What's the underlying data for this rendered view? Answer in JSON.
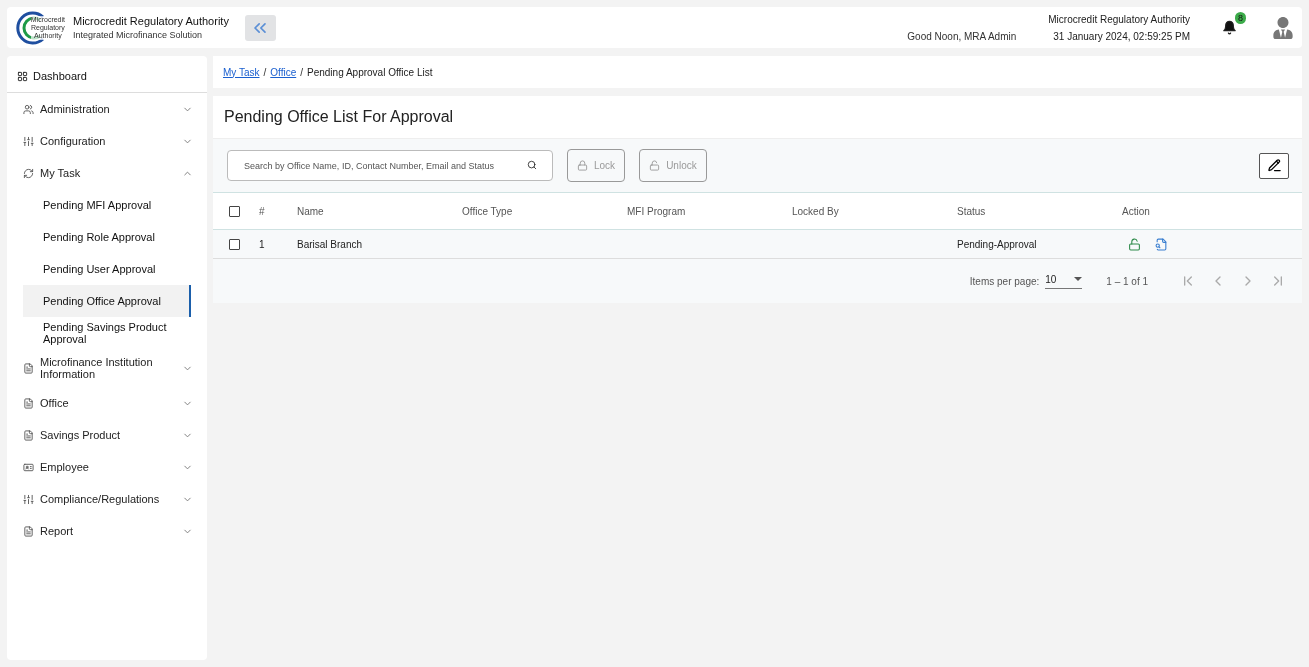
{
  "header": {
    "logo_text": [
      "Microcredit",
      "Regulatory",
      "Authority"
    ],
    "title": "Microcredit Regulatory Authority",
    "subtitle": "Integrated Microfinance Solution",
    "greeting": "Good Noon, MRA Admin",
    "org": "Microcredit Regulatory Authority",
    "datetime": "31 January 2024, 02:59:25 PM",
    "notifications": "8"
  },
  "sidebar": {
    "dashboard": "Dashboard",
    "items": [
      {
        "label": "Administration",
        "expanded": false
      },
      {
        "label": "Configuration",
        "expanded": false
      },
      {
        "label": "My Task",
        "expanded": true,
        "children": [
          {
            "label": "Pending MFI Approval",
            "selected": false
          },
          {
            "label": "Pending Role Approval",
            "selected": false
          },
          {
            "label": "Pending User Approval",
            "selected": false
          },
          {
            "label": "Pending Office Approval",
            "selected": true
          },
          {
            "label": "Pending Savings Product Approval",
            "selected": false
          }
        ]
      },
      {
        "label": "Microfinance Institution Information",
        "expanded": false
      },
      {
        "label": "Office",
        "expanded": false
      },
      {
        "label": "Savings Product",
        "expanded": false
      },
      {
        "label": "Employee",
        "expanded": false
      },
      {
        "label": "Compliance/Regulations",
        "expanded": false
      },
      {
        "label": "Report",
        "expanded": false
      }
    ]
  },
  "breadcrumb": {
    "separators": [
      "/",
      "/"
    ],
    "items": [
      "My Task",
      "Office",
      "Pending Approval Office List"
    ]
  },
  "page_title": "Pending Office List For Approval",
  "search": {
    "placeholder": "Search by Office Name, ID, Contact Number, Email and Status"
  },
  "buttons": [
    {
      "label": "Lock",
      "kind": "lock",
      "disabled": true
    },
    {
      "label": "Unlock",
      "kind": "unlock",
      "disabled": true
    }
  ],
  "table": {
    "header_checked": false,
    "columns": [
      "#",
      "Name",
      "Office Type",
      "MFI Program",
      "Locked By",
      "Status",
      "Action"
    ],
    "rows": [
      {
        "checked": false,
        "cells": [
          "1",
          "Barisal Branch",
          "",
          "",
          "",
          "Pending-Approval"
        ]
      }
    ]
  },
  "pagination": {
    "label": "Items per page:",
    "page_size": "10",
    "range": "1 – 1 of 1"
  }
}
